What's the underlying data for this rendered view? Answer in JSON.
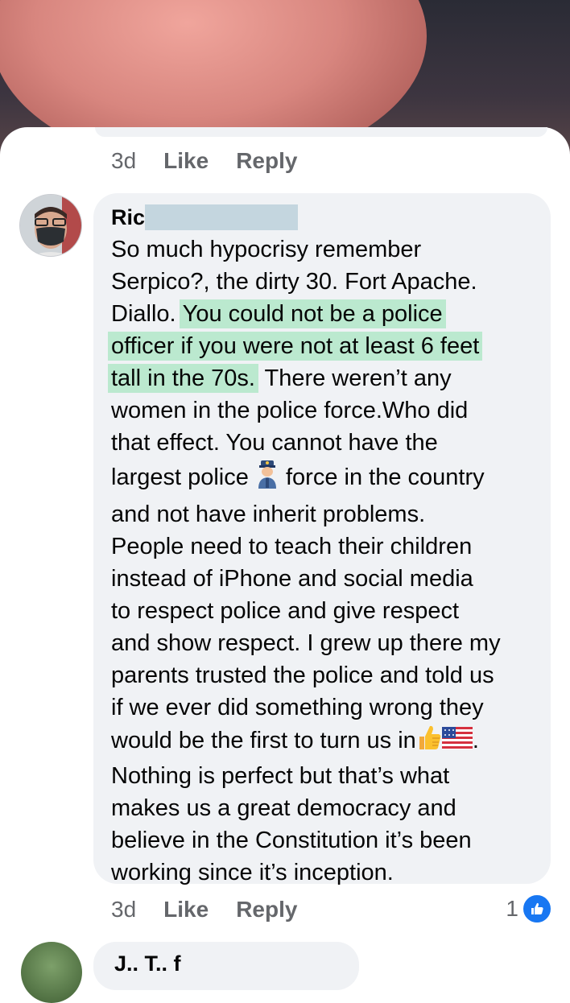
{
  "previous_comment": {
    "time": "3d",
    "like_label": "Like",
    "reply_label": "Reply"
  },
  "comment": {
    "author": "Ric",
    "text_before": "So much hypocrisy remember\nSerpico?, the dirty 30. Fort Apache.\nDiallo. ",
    "highlighted": "You could not be a police\nofficer if you were not at least 6 feet\ntall in the 70s.",
    "text_after_1": "  There weren’t any\nwomen in the police force.Who did\nthat effect. You cannot have the\nlargest police ",
    "emoji_police": "police-officer-icon",
    "text_after_2": " force in the country\nand not have inherit problems.\nPeople need to teach their children\ninstead of iPhone and social media\nto respect police and give respect\nand show respect. I grew up there my\nparents trusted the police and told us\nif we ever did something wrong they\nwould be the first to turn us in",
    "emoji_thumbs": "thumbs-up-icon",
    "emoji_flag": "us-flag-icon",
    "text_after_3": ".\nNothing is perfect but that’s what\nmakes us a great democracy and\nbelieve in the Constitution it’s been\nworking since it’s inception.",
    "time": "3d",
    "like_label": "Like",
    "reply_label": "Reply",
    "reaction_count": "1",
    "reaction_icon": "like-reaction-icon"
  },
  "next_comment": {
    "author_partial": "J.. T.. f"
  },
  "colors": {
    "highlight": "#bbe9cf",
    "bubble": "#f0f2f5",
    "meta": "#65676b",
    "like_blue": "#1877f2",
    "redaction": "#c4d6df"
  }
}
